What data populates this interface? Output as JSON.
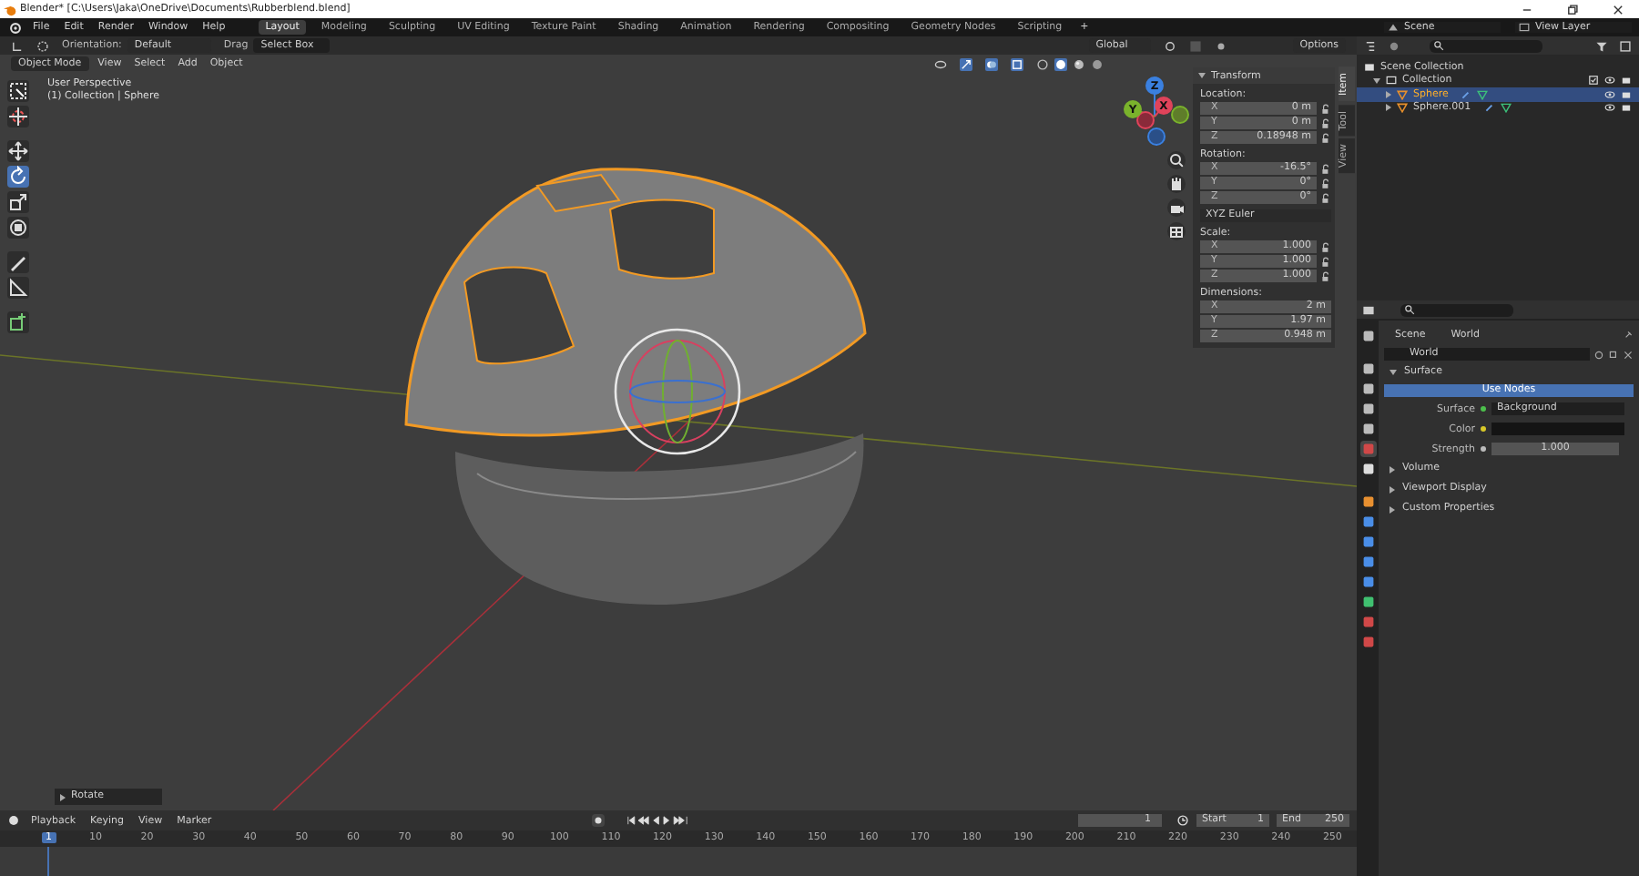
{
  "title_bar": {
    "title": "Blender* [C:\\Users\\Jaka\\OneDrive\\Documents\\Rubberblend.blend]"
  },
  "menu": [
    "File",
    "Edit",
    "Render",
    "Window",
    "Help"
  ],
  "workspaces": [
    {
      "label": "Layout",
      "selected": true
    },
    {
      "label": "Modeling",
      "selected": false
    },
    {
      "label": "Sculpting",
      "selected": false
    },
    {
      "label": "UV Editing",
      "selected": false
    },
    {
      "label": "Texture Paint",
      "selected": false
    },
    {
      "label": "Shading",
      "selected": false
    },
    {
      "label": "Animation",
      "selected": false
    },
    {
      "label": "Rendering",
      "selected": false
    },
    {
      "label": "Compositing",
      "selected": false
    },
    {
      "label": "Geometry Nodes",
      "selected": false
    },
    {
      "label": "Scripting",
      "selected": false
    }
  ],
  "add_workspace": "+",
  "scene": "Scene",
  "view_layer": "View Layer",
  "tool_header": {
    "orientation_label": "Orientation:",
    "orientation": "Default",
    "drag_label": "Drag",
    "drag": "Select Box",
    "transform_orientation": "Global",
    "options": "Options"
  },
  "mode_bar": {
    "mode": "Object Mode",
    "menus": [
      "View",
      "Select",
      "Add",
      "Object"
    ]
  },
  "tools": [
    {
      "kind": "select",
      "selected": false
    },
    {
      "kind": "cursor",
      "selected": false
    },
    {
      "kind": "move",
      "selected": false
    },
    {
      "kind": "rotate",
      "selected": true
    },
    {
      "kind": "scale",
      "selected": false
    },
    {
      "kind": "transform",
      "selected": false
    },
    {
      "kind": "annotate",
      "selected": false
    },
    {
      "kind": "measure",
      "selected": false
    },
    {
      "kind": "add_cube",
      "selected": false
    }
  ],
  "viewport": {
    "view_name": "User Perspective",
    "object_info": "(1) Collection | Sphere",
    "last_operator": "Rotate"
  },
  "nav_gizmo": [
    {
      "label": "X",
      "color": "#e0435a"
    },
    {
      "label": "Y",
      "color": "#7ab32c"
    },
    {
      "label": "Z",
      "color": "#3a80e0"
    }
  ],
  "sidebar": {
    "tabs": [
      {
        "label": "Item",
        "selected": true
      },
      {
        "label": "Tool",
        "selected": false
      },
      {
        "label": "View",
        "selected": false
      }
    ],
    "panel_title": "Transform",
    "groups": [
      {
        "label": "Location:",
        "locks": true,
        "fields": [
          {
            "axis": "X",
            "value": "0 m"
          },
          {
            "axis": "Y",
            "value": "0 m"
          },
          {
            "axis": "Z",
            "value": "0.18948 m"
          }
        ]
      },
      {
        "label": "Rotation:",
        "locks": true,
        "fields": [
          {
            "axis": "X",
            "value": "-16.5°"
          },
          {
            "axis": "Y",
            "value": "0°"
          },
          {
            "axis": "Z",
            "value": "0°"
          }
        ],
        "mode": "XYZ Euler"
      },
      {
        "label": "Scale:",
        "locks": true,
        "fields": [
          {
            "axis": "X",
            "value": "1.000"
          },
          {
            "axis": "Y",
            "value": "1.000"
          },
          {
            "axis": "Z",
            "value": "1.000"
          }
        ]
      },
      {
        "label": "Dimensions:",
        "locks": false,
        "fields": [
          {
            "axis": "X",
            "value": "2 m"
          },
          {
            "axis": "Y",
            "value": "1.97 m"
          },
          {
            "axis": "Z",
            "value": "0.948 m"
          }
        ]
      }
    ]
  },
  "outliner": {
    "root": "Scene Collection",
    "items": [
      {
        "label": "Collection",
        "expanded": true,
        "selected": false,
        "children": [
          {
            "label": "Sphere",
            "expanded": false,
            "selected": true
          },
          {
            "label": "Sphere.001",
            "expanded": false,
            "selected": false
          }
        ]
      }
    ]
  },
  "property_tabs": [
    {
      "kind": "tool",
      "selected": false
    },
    {
      "kind": "render",
      "selected": false
    },
    {
      "kind": "output",
      "selected": false
    },
    {
      "kind": "view_layer",
      "selected": false
    },
    {
      "kind": "scene",
      "selected": false
    },
    {
      "kind": "world",
      "selected": true
    },
    {
      "kind": "collection",
      "selected": false
    },
    {
      "kind": "object",
      "selected": false
    },
    {
      "kind": "modifiers",
      "selected": false
    },
    {
      "kind": "particles",
      "selected": false
    },
    {
      "kind": "physics",
      "selected": false
    },
    {
      "kind": "constraints",
      "selected": false
    },
    {
      "kind": "data",
      "selected": false
    },
    {
      "kind": "material",
      "selected": false
    },
    {
      "kind": "texture",
      "selected": false
    }
  ],
  "properties": {
    "context": [
      "Scene",
      "World"
    ],
    "world": "World",
    "panels": [
      {
        "label": "Surface",
        "expanded": true,
        "use_nodes": "Use Nodes",
        "rows": [
          {
            "kind": "shader",
            "label": "Surface",
            "value": "Background",
            "color": "#4cc04c"
          },
          {
            "kind": "color",
            "label": "Color",
            "color": "#d8c828"
          },
          {
            "kind": "number",
            "label": "Strength",
            "value": "1.000"
          }
        ]
      },
      {
        "label": "Volume",
        "expanded": false
      },
      {
        "label": "Viewport Display",
        "expanded": false
      },
      {
        "label": "Custom Properties",
        "expanded": false
      }
    ]
  },
  "timeline": {
    "menus": [
      "Playback",
      "Keying",
      "View",
      "Marker"
    ],
    "current_frame": "1",
    "start_label": "Start",
    "start": "1",
    "end_label": "End",
    "end": "250",
    "playhead": "1",
    "ruler": [
      "10",
      "20",
      "30",
      "40",
      "50",
      "60",
      "70",
      "80",
      "90",
      "100",
      "110",
      "120",
      "130",
      "140",
      "150",
      "160",
      "170",
      "180",
      "190",
      "200",
      "210",
      "220",
      "230",
      "240",
      "250"
    ]
  }
}
